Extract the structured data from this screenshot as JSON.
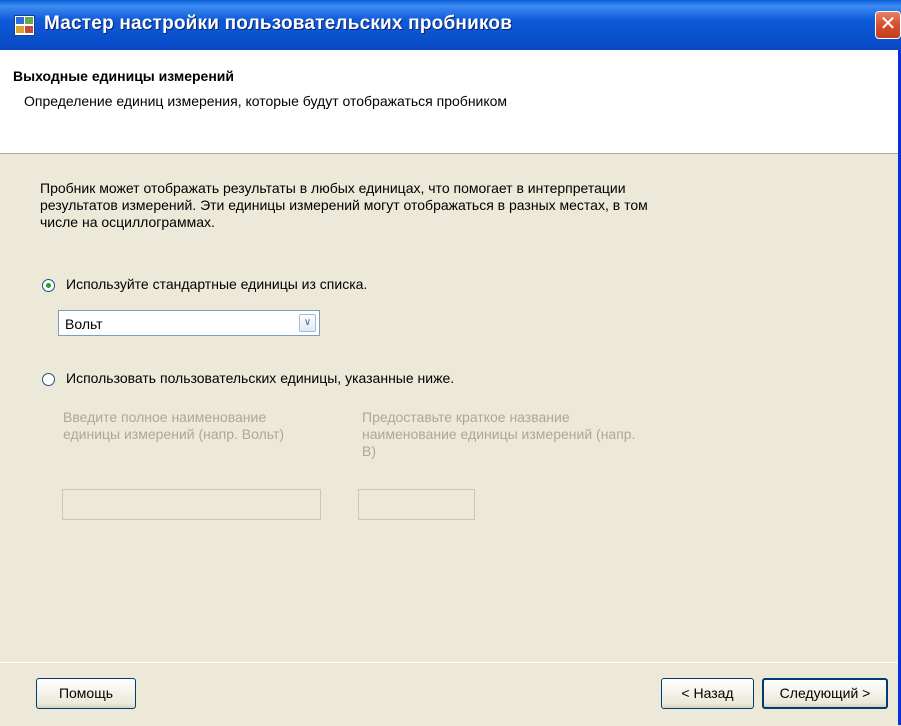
{
  "window": {
    "title": "Мастер настройки пользовательских пробников",
    "close_glyph": "✕"
  },
  "header": {
    "title": "Выходные единицы измерений",
    "subtitle": "Определение единиц измерения, которые будут отображаться пробником"
  },
  "body": {
    "description": "Пробник может отображать результаты в любых единицах, что помогает в интерпретации результатов измерений. Эти единицы измерений могут отображаться в разных местах, в том числе на осциллограммах.",
    "option_standard": {
      "label": "Используйте стандартные единицы из списка.",
      "selected": true
    },
    "units_dropdown": {
      "value": "Вольт",
      "arrow_glyph": "∨"
    },
    "option_custom": {
      "label": "Использовать пользовательских единицы, указанные ниже.",
      "selected": false
    },
    "full_name_label": "Введите полное наименование единицы измерений (напр. Вольт)",
    "short_name_label": "Предоставьте краткое название наименование единицы измерений (напр. В)",
    "full_name_value": "",
    "short_name_value": ""
  },
  "footer": {
    "help": "Помощь",
    "back": "< Назад",
    "next": "Следующий >"
  },
  "colors": {
    "titlebar": "#0a4fcc",
    "face": "#ece9d8",
    "radio_dot": "#21a121",
    "close_button": "#d4502e",
    "disabled_text": "#aca899"
  },
  "icons": {
    "app": "wizard-window-icon",
    "close": "close-icon",
    "dropdown": "chevron-down-icon"
  }
}
